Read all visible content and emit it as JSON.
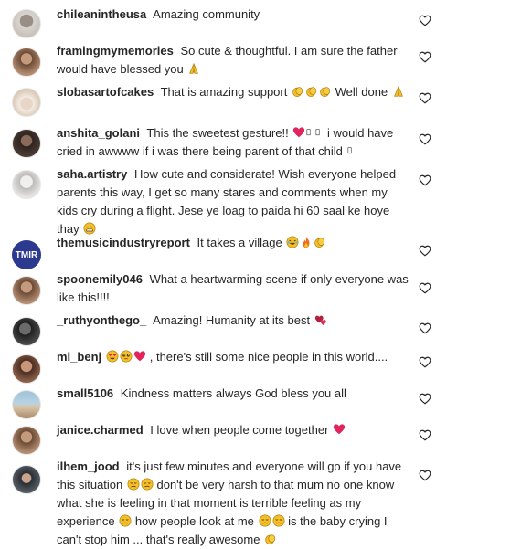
{
  "comments": [
    {
      "username": "chileanintheusa",
      "text": "Amazing community",
      "avatar": "gray-portrait"
    },
    {
      "username": "framingmymemories",
      "text": "So cute & thoughtful. I am sure the father would have blessed you",
      "emojis_after": [
        "praying-hands"
      ],
      "avatar": "woman-portrait"
    },
    {
      "username": "slobasartofcakes",
      "text": "That is amazing support",
      "emojis_mid": [
        "clapping-hands",
        "clapping-hands",
        "clapping-hands"
      ],
      "text2": "Well done",
      "emojis_after": [
        "praying-hands"
      ],
      "avatar": "cake-portrait"
    },
    {
      "username": "anshita_golani",
      "text": "This the sweetest gesture!!",
      "emojis_mid": [
        "red-heart",
        "unknown-glyph",
        "unknown-glyph"
      ],
      "text2": "i would have cried in awwww if i was there being parent of that child",
      "emojis_after": [
        "unknown-glyph"
      ],
      "avatar": "dark-portrait"
    },
    {
      "username": "saha.artistry",
      "text": "How cute and considerate! Wish everyone helped parents this way, I get so many stares and comments when my kids cry during a flight. Jese ye loag to paida hi 60 saal ke hoye thay",
      "emojis_after": [
        "grimacing-face"
      ],
      "avatar": "sketch-portrait"
    },
    {
      "username": "themusicindustryreport",
      "text": "It takes a village",
      "emojis_after": [
        "laughing-face",
        "fire",
        "clapping-hands"
      ],
      "avatar": "TMIR"
    },
    {
      "username": "spoonemily046",
      "text": "What a heartwarming scene if only everyone was like this!!!!",
      "avatar": "woman-portrait"
    },
    {
      "username": "_ruthyonthego_",
      "text": "Amazing! Humanity at its best",
      "emojis_after": [
        "two-hearts"
      ],
      "avatar": "bw-portrait"
    },
    {
      "username": "mi_benj",
      "text": ", there's still some nice people in this world....",
      "emojis_before": [
        "heart-eyes",
        "pleading-face",
        "red-heart"
      ],
      "avatar": "selfie-portrait"
    },
    {
      "username": "small5106",
      "text": "Kindness matters always God bless you all",
      "avatar": "beach-portrait"
    },
    {
      "username": "janice.charmed",
      "text": "I love when people come together",
      "emojis_after": [
        "red-heart"
      ],
      "avatar": "woman-portrait"
    },
    {
      "username": "ilhem_jood",
      "text": "it's just few minutes and everyone will go if you have this situation",
      "emojis_mid": [
        "disappointed-face",
        "disappointed-face"
      ],
      "text2": "don't be very harsh to that mum no one know what she is feeling in that moment is terrible feeling as my experience",
      "emojis_mid2": [
        "disappointed-face"
      ],
      "text3": "how people look at me",
      "emojis_mid3": [
        "disappointed-face",
        "disappointed-face"
      ],
      "text4": "is the baby crying I can't stop him ... that's really awesome",
      "emojis_after": [
        "clapping-hands"
      ],
      "avatar": "hijab-portrait"
    }
  ],
  "colors": {
    "text": "#262626",
    "heart_outline": "#262626",
    "red_heart": "#e0245e",
    "emoji_yellow": "#f4c02a",
    "tmir_bg": "#2b3a8f"
  }
}
